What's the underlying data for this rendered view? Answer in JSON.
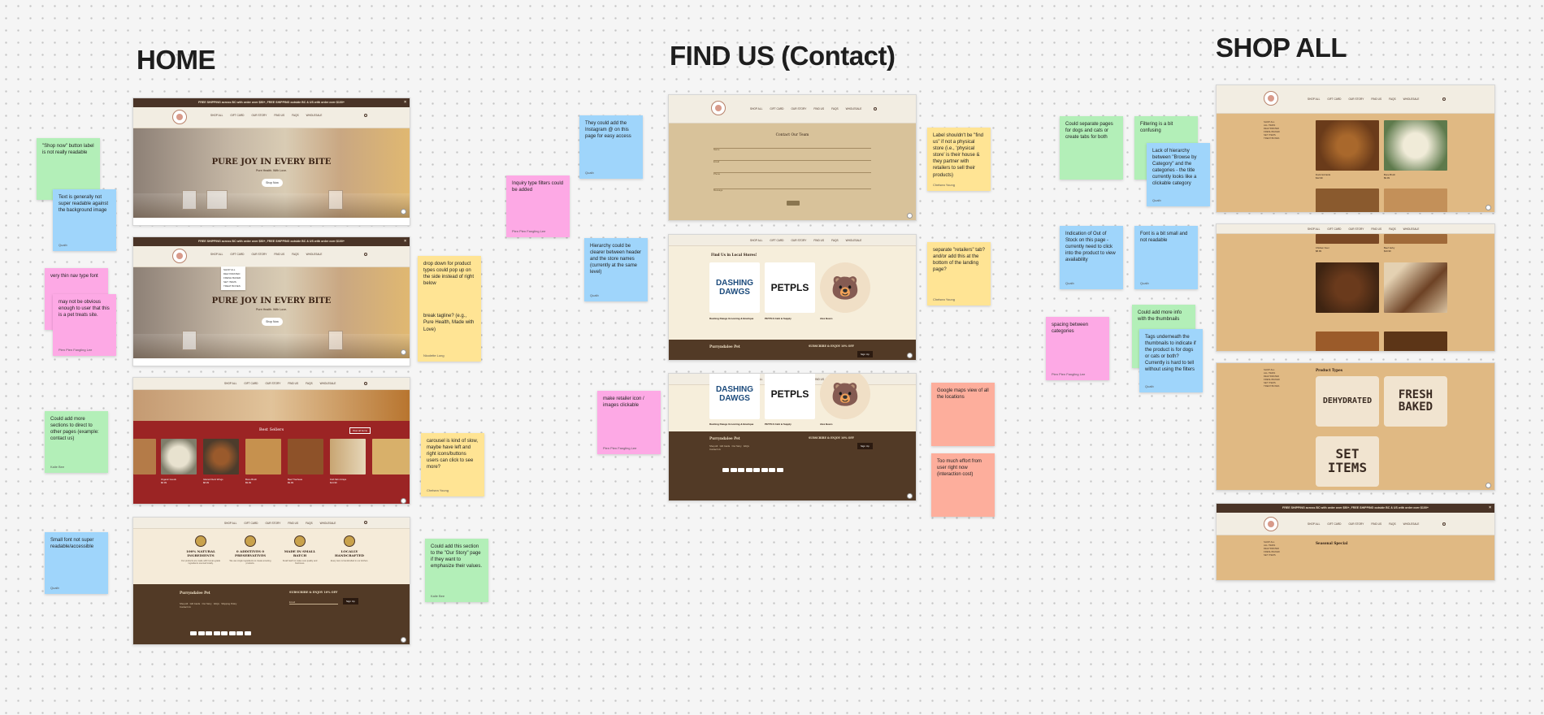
{
  "board": {
    "sections": {
      "home": "HOME",
      "find_us": "FIND US (Contact)",
      "shop_all": "SHOP ALL"
    }
  },
  "site": {
    "banner": "FREE SHIPPING across BC with order over $50+, FREE SHIPPING outside BC & US with order over $100+",
    "nav": [
      "SHOP ALL",
      "GIFT CARD",
      "OUR STORY",
      "FIND US",
      "FAQS",
      "WHOLESALE"
    ],
    "hero_headline": "PURE JOY IN EVERY BITE",
    "hero_sub": "Pure Health. With Love.",
    "hero_button": "Shop Now",
    "dropdown_items": [
      "SHOP ALL",
      "DEHYDRATED",
      "FRESH BAKED",
      "SET ITEMS",
      "TREAT BOXES"
    ],
    "best_sellers": "Best Sellers",
    "view_all": "View all items",
    "best_seller_items": [
      {
        "name": "Organic Goods",
        "price": "$6.99"
      },
      {
        "name": "Glazed Duck Wings",
        "price": "$8.99"
      },
      {
        "name": "Bone Broth",
        "price": "$9.99"
      },
      {
        "name": "Beef Tracheas",
        "price": "$9.99"
      },
      {
        "name": "Fish Skin Crisps",
        "price": "$14.99"
      }
    ],
    "values": [
      {
        "title": "100% NATURAL INGREDIENTS",
        "body": "Our products are made with human-grade ingredients sourced locally."
      },
      {
        "title": "0 ADDITIVES 0 PRESERVATIVES",
        "body": "We use single ingredients to create amazing products."
      },
      {
        "title": "MADE IN SMALL BATCH",
        "body": "Small batch to make sure quality and freshness."
      },
      {
        "title": "LOCALLY HANDCRAFTED",
        "body": "Every item is handcrafted in our kitchen."
      }
    ],
    "footer_brand": "Purryndalee Pet",
    "footer_links": [
      "Shop All",
      "Gift Cards",
      "Our Story",
      "FAQs",
      "Shipping Policy",
      "Contact Us"
    ],
    "subscribe": "SUBSCRIBE & ENJOY 10% OFF",
    "email_placeholder": "Email",
    "sign_up": "Sign Up",
    "contact_title": "Contact Our Team",
    "contact_fields": [
      "Name",
      "Email",
      "Phone",
      "Message"
    ],
    "retail_title": "Find Us in Local Stores!",
    "retailers": [
      {
        "name": "Dashing Dawgs Grooming & Boutique",
        "card": "DASHING DAWGS"
      },
      {
        "name": "PETPLS Café & Supply",
        "card": "PETPLS"
      },
      {
        "name": "Alex Bears",
        "card": "🐻"
      }
    ],
    "shop_sidebar": [
      "SHOP ALL",
      "ALL ITEMS",
      "DEHYDRATED",
      "FRESH BAKED",
      "SET ITEMS",
      "TREAT BOXES"
    ],
    "shop_products": [
      {
        "name": "Duck Gizzards",
        "price": "$12.99"
      },
      {
        "name": "Bone Broth",
        "price": "$9.99"
      },
      {
        "name": "Chicken Feet",
        "price": "$8.99"
      },
      {
        "name": "Beef Jerky",
        "price": "$10.99"
      }
    ],
    "product_types": "Product Types",
    "types": [
      "DEHYDRATED",
      "FRESH BAKED",
      "SET ITEMS"
    ],
    "seasonal": "Seasonal Special"
  },
  "stickies": [
    {
      "id": "s1",
      "text": "\"Shop now\" button label is not really readable",
      "author": ""
    },
    {
      "id": "s2",
      "text": "Text is generally not super readable against the background image",
      "author": "Qualb"
    },
    {
      "id": "s3",
      "text": "very thin nav type font",
      "author": ""
    },
    {
      "id": "s4",
      "text": "may not be obvious enough to user that this is a pet treats site.",
      "author": "Pien Pien Fangling Lee"
    },
    {
      "id": "s5",
      "text": "Could add more sections to direct to other pages (example: contact us)",
      "author": "Kalie Bee"
    },
    {
      "id": "s6",
      "text": "Small font not super readable/accessible",
      "author": "Qualb"
    },
    {
      "id": "s7",
      "text": "drop down for product types could pop up on the side instead of right below",
      "author": ""
    },
    {
      "id": "s8",
      "text": "break tagline? (e.g., Pure Health, Made with Love)",
      "author": "Nicolette Long"
    },
    {
      "id": "s9",
      "text": "carousel is kind of slow, maybe have left and right icons/buttons users can click to see more?",
      "author": "Chelsea Young"
    },
    {
      "id": "s10",
      "text": "Could add this section to the \"Our Story\" page if they want to emphasize their values.",
      "author": "Kalie Bee"
    },
    {
      "id": "s11",
      "text": "Inquiry type filters could be added",
      "author": "Pien Pien Fangling Lee"
    },
    {
      "id": "s12",
      "text": "They could add the Instagram @ on this page for easy access",
      "author": "Qualb"
    },
    {
      "id": "s13",
      "text": "Hierarchy could be clearer between header and the store names (currently at the same level)",
      "author": "Qualb"
    },
    {
      "id": "s14",
      "text": "make retailer icon / images clickable",
      "author": "Pien Pien Fangling Lee"
    },
    {
      "id": "s15",
      "text": "Label shouldn't be \"find us\" if not a physical store (i.e., 'physical store' is their house & they partner with retailers to sell their products)",
      "author": "Chelsea Young"
    },
    {
      "id": "s16",
      "text": "separate \"retailers\" tab? and/or add this at the bottom of the landing page?",
      "author": "Chelsea Young"
    },
    {
      "id": "s17",
      "text": "Google maps view of all the locations",
      "author": ""
    },
    {
      "id": "s18",
      "text": "Too much effort from user right now (interaction cost)",
      "author": ""
    },
    {
      "id": "s19",
      "text": "Could separate pages for dogs and cats or create tabs for both",
      "author": ""
    },
    {
      "id": "s20",
      "text": "Filtering is a bit confusing",
      "author": ""
    },
    {
      "id": "s21",
      "text": "Lack of hierarchy between \"Browse by Category\" and the categories - the title currently looks like a clickable category",
      "author": "Qualb"
    },
    {
      "id": "s22",
      "text": "Indication of Out of Stock on this page - currently need to click into the product to view availability",
      "author": "Qualb"
    },
    {
      "id": "s23",
      "text": "Font is a bit small and not readable",
      "author": "Qualb"
    },
    {
      "id": "s24",
      "text": "spacing between categories",
      "author": "Pien Pien Fangling Lee"
    },
    {
      "id": "s25",
      "text": "Could add more info with the thumbnails",
      "author": ""
    },
    {
      "id": "s26",
      "text": "Tags underneath the thumbnails to indicate if the product is for dogs or cats or both? Currently is hard to tell without using the filters",
      "author": "Qualb"
    }
  ]
}
